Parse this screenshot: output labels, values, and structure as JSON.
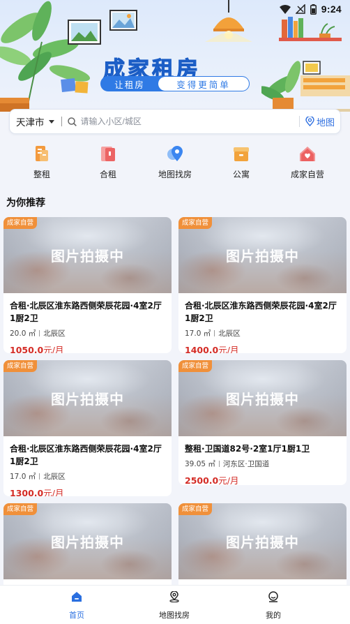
{
  "status_bar": {
    "time": "9:24"
  },
  "banner": {
    "title": "成家租房",
    "slogan_left": "让租房",
    "slogan_right": "变得更简单"
  },
  "search": {
    "city": "天津市",
    "placeholder": "请输入小区/城区",
    "map_label": "地图"
  },
  "categories": [
    {
      "label": "整租",
      "icon": "whole-rent-icon",
      "color": "#f39a3e"
    },
    {
      "label": "合租",
      "icon": "shared-rent-icon",
      "color": "#ee6b6b"
    },
    {
      "label": "地图找房",
      "icon": "map-pin-icon",
      "color": "#3b86f0"
    },
    {
      "label": "公寓",
      "icon": "apartment-box-icon",
      "color": "#f2a33c"
    },
    {
      "label": "成家自营",
      "icon": "home-heart-icon",
      "color": "#ef6e6e"
    }
  ],
  "section_title": "为你推荐",
  "listings": [
    {
      "badge": "成家自营",
      "image_text": "图片拍摄中",
      "title": "合租·北辰区淮东路西侧荣辰花园·4室2厅1厨2卫",
      "area": "20.0 ㎡",
      "district": "北辰区",
      "price": "1050.0",
      "unit": "元/月"
    },
    {
      "badge": "成家自营",
      "image_text": "图片拍摄中",
      "title": "合租·北辰区淮东路西侧荣辰花园·4室2厅1厨2卫",
      "area": "17.0 ㎡",
      "district": "北辰区",
      "price": "1400.0",
      "unit": "元/月"
    },
    {
      "badge": "成家自营",
      "image_text": "图片拍摄中",
      "title": "合租·北辰区淮东路西侧荣辰花园·4室2厅1厨2卫",
      "area": "17.0 ㎡",
      "district": "北辰区",
      "price": "1300.0",
      "unit": "元/月"
    },
    {
      "badge": "成家自营",
      "image_text": "图片拍摄中",
      "title": "整租·卫国道82号·2室1厅1厨1卫",
      "area": "39.05 ㎡",
      "district": "河东区·卫国道",
      "price": "2500.0",
      "unit": "元/月"
    },
    {
      "badge": "成家自营",
      "image_text": "图片拍摄中"
    },
    {
      "badge": "成家自营",
      "image_text": "图片拍摄中"
    }
  ],
  "tabbar": [
    {
      "label": "首页",
      "icon": "home-icon",
      "active": true
    },
    {
      "label": "地图找房",
      "icon": "map-location-icon",
      "active": false
    },
    {
      "label": "我的",
      "icon": "profile-icon",
      "active": false
    }
  ],
  "colors": {
    "accent": "#2a6fe0",
    "price": "#d42c26",
    "badge": "#f0903a"
  }
}
